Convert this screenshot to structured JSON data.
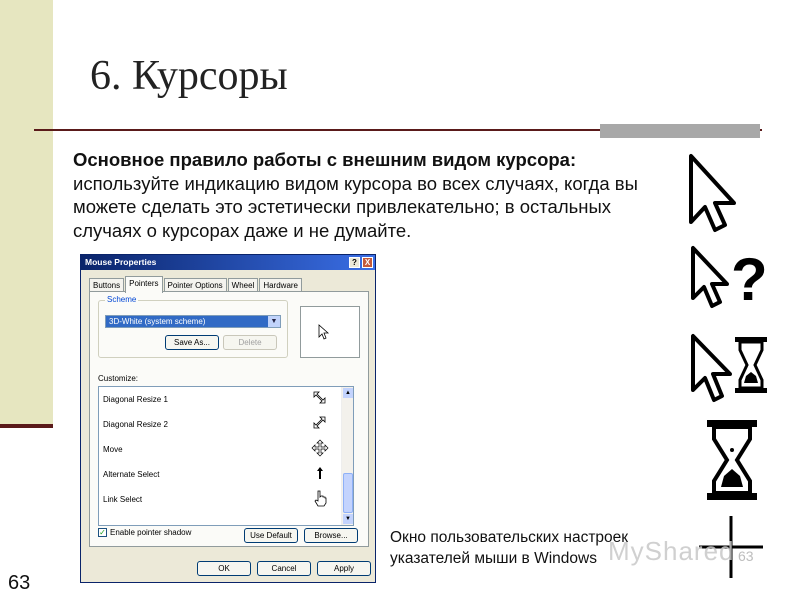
{
  "slide": {
    "title": "6. Курсоры",
    "body_bold": "Основное правило работы с внешним видом курсора:",
    "body_text": "используйте индикацию видом курсора во всех случаях, когда вы можете сделать это эстетически привлекательно; в остальных случаях о курсорах даже и не думайте.",
    "caption": "Окно пользовательских настроек указателей мыши в Windows",
    "page_number": "63",
    "watermark": "MyShared",
    "watermark_number": "63"
  },
  "dialog": {
    "title": "Mouse Properties",
    "help_btn": "?",
    "close_btn": "X",
    "tabs": [
      "Buttons",
      "Pointers",
      "Pointer Options",
      "Wheel",
      "Hardware"
    ],
    "active_tab": "Pointers",
    "scheme_label": "Scheme",
    "scheme_value": "3D-White (system scheme)",
    "save_as": "Save As...",
    "delete": "Delete",
    "customize_label": "Customize:",
    "list_items": [
      {
        "name": "Diagonal Resize 1",
        "icon": "diagonal-resize-1-icon"
      },
      {
        "name": "Diagonal Resize 2",
        "icon": "diagonal-resize-2-icon"
      },
      {
        "name": "Move",
        "icon": "move-icon"
      },
      {
        "name": "Alternate Select",
        "icon": "up-arrow-icon"
      },
      {
        "name": "Link Select",
        "icon": "hand-icon"
      }
    ],
    "enable_shadow": "Enable pointer shadow",
    "use_default": "Use Default",
    "browse": "Browse...",
    "ok": "OK",
    "cancel": "Cancel",
    "apply": "Apply"
  },
  "icons": [
    "arrow-icon",
    "help-arrow-icon",
    "busy-arrow-icon",
    "hourglass-icon",
    "crosshair-icon"
  ]
}
